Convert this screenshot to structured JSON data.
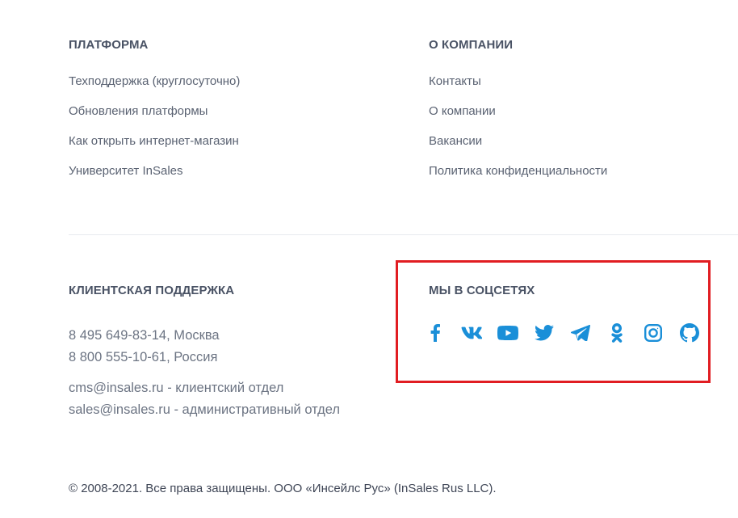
{
  "platform": {
    "title": "ПЛАТФОРМА",
    "links": [
      "Техподдержка (круглосуточно)",
      "Обновления платформы",
      "Как открыть интернет-магазин",
      "Университет InSales"
    ]
  },
  "company": {
    "title": "О КОМПАНИИ",
    "links": [
      "Контакты",
      "О компании",
      "Вакансии",
      "Политика конфиденциальности"
    ]
  },
  "support": {
    "title": "КЛИЕНТСКАЯ ПОДДЕРЖКА",
    "phones": [
      "8 495 649-83-14, Москва",
      "8 800 555-10-61, Россия"
    ],
    "emails": [
      "cms@insales.ru - клиентский отдел",
      "sales@insales.ru - административный отдел"
    ]
  },
  "social": {
    "title": "МЫ В СОЦСЕТЯХ",
    "icons": [
      "facebook-icon",
      "vk-icon",
      "youtube-icon",
      "twitter-icon",
      "telegram-icon",
      "odnoklassniki-icon",
      "instagram-icon",
      "github-icon"
    ],
    "icon_color": "#1a8fd8",
    "highlight_color": "#e11d22"
  },
  "copyright": "© 2008-2021. Все права защищены. ООО «Инсейлс Рус» (InSales Rus LLC)."
}
